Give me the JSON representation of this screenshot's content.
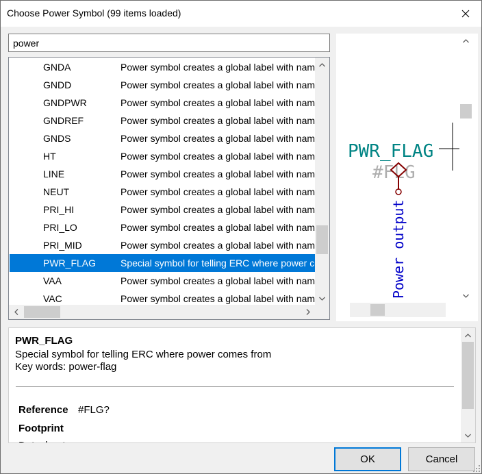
{
  "window": {
    "title": "Choose Power Symbol (99 items loaded)"
  },
  "search": {
    "value": "power"
  },
  "list": {
    "items": [
      {
        "name": "GNDA",
        "desc": "Power symbol creates a global label with name"
      },
      {
        "name": "GNDD",
        "desc": "Power symbol creates a global label with name"
      },
      {
        "name": "GNDPWR",
        "desc": "Power symbol creates a global label with name"
      },
      {
        "name": "GNDREF",
        "desc": "Power symbol creates a global label with name"
      },
      {
        "name": "GNDS",
        "desc": "Power symbol creates a global label with name"
      },
      {
        "name": "HT",
        "desc": "Power symbol creates a global label with name"
      },
      {
        "name": "LINE",
        "desc": "Power symbol creates a global label with name"
      },
      {
        "name": "NEUT",
        "desc": "Power symbol creates a global label with name"
      },
      {
        "name": "PRI_HI",
        "desc": "Power symbol creates a global label with name"
      },
      {
        "name": "PRI_LO",
        "desc": "Power symbol creates a global label with name"
      },
      {
        "name": "PRI_MID",
        "desc": "Power symbol creates a global label with name"
      },
      {
        "name": "PWR_FLAG",
        "desc": "Special symbol for telling ERC where power comes from"
      },
      {
        "name": "VAA",
        "desc": "Power symbol creates a global label with name"
      },
      {
        "name": "VAC",
        "desc": "Power symbol creates a global label with name"
      }
    ],
    "selected_name": "PWR_FLAG"
  },
  "preview": {
    "value_text": "PWR_FLAG",
    "ref_text": "#FLG",
    "pin_text": "Power output"
  },
  "details": {
    "name": "PWR_FLAG",
    "description": "Special symbol for telling ERC where power comes from",
    "keywords": "Key words: power-flag",
    "reference_label": "Reference",
    "reference_value": "#FLG?",
    "footprint_label": "Footprint",
    "cut_text": "Datasheet"
  },
  "buttons": {
    "ok": "OK",
    "cancel": "Cancel"
  },
  "colors": {
    "selection": "#0078d7",
    "preview_value": "#008484",
    "preview_ref": "#a0a0a0",
    "preview_pin_text": "#0000c8",
    "preview_body": "#840000"
  }
}
